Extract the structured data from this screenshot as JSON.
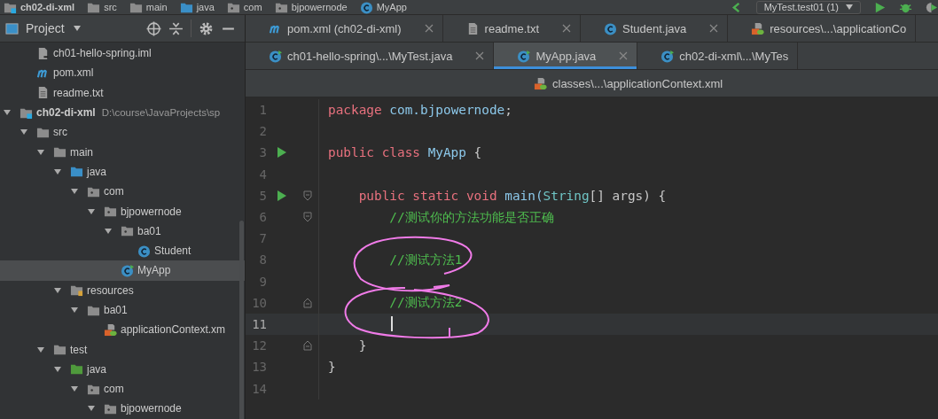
{
  "breadcrumbs": [
    {
      "label": "ch02-di-xml",
      "kind": "module"
    },
    {
      "label": "src",
      "kind": "folder"
    },
    {
      "label": "main",
      "kind": "folder"
    },
    {
      "label": "java",
      "kind": "source"
    },
    {
      "label": "com",
      "kind": "package"
    },
    {
      "label": "bjpowernode",
      "kind": "package"
    },
    {
      "label": "MyApp",
      "kind": "class"
    }
  ],
  "run_config": {
    "label": "MyTest.test01 (1)"
  },
  "project_panel": {
    "title": "Project"
  },
  "tree": {
    "scrolled_items": [
      {
        "label": "ch01-hello-spring.iml",
        "kind": "iml",
        "selected": false
      },
      {
        "label": "pom.xml",
        "kind": "maven",
        "selected": false
      },
      {
        "label": "readme.txt",
        "kind": "text",
        "selected": false
      }
    ],
    "items": [
      {
        "label": "ch02-di-xml",
        "hint": "D:\\course\\JavaProjects\\sp",
        "kind": "module",
        "selected": false,
        "expanded": true,
        "children": [
          {
            "label": "src",
            "kind": "folder",
            "selected": false,
            "expanded": true,
            "children": [
              {
                "label": "main",
                "kind": "folder",
                "selected": false,
                "expanded": true,
                "children": [
                  {
                    "label": "java",
                    "kind": "source",
                    "selected": false,
                    "expanded": true,
                    "children": [
                      {
                        "label": "com",
                        "kind": "package",
                        "selected": false,
                        "expanded": true,
                        "children": [
                          {
                            "label": "bjpowernode",
                            "kind": "package",
                            "selected": false,
                            "expanded": true,
                            "children": [
                              {
                                "label": "ba01",
                                "kind": "package",
                                "selected": false,
                                "expanded": true,
                                "children": [
                                  {
                                    "label": "Student",
                                    "kind": "class",
                                    "selected": false
                                  }
                                ]
                              },
                              {
                                "label": "MyApp",
                                "kind": "main",
                                "selected": true
                              }
                            ]
                          }
                        ]
                      }
                    ]
                  },
                  {
                    "label": "resources",
                    "kind": "resources",
                    "selected": false,
                    "expanded": true,
                    "children": [
                      {
                        "label": "ba01",
                        "kind": "folder",
                        "selected": false,
                        "expanded": true,
                        "children": [
                          {
                            "label": "applicationContext.xm",
                            "kind": "spring",
                            "selected": false
                          }
                        ]
                      }
                    ]
                  }
                ]
              },
              {
                "label": "test",
                "kind": "folder",
                "selected": false,
                "expanded": true,
                "children": [
                  {
                    "label": "java",
                    "kind": "test",
                    "selected": false,
                    "expanded": true,
                    "children": [
                      {
                        "label": "com",
                        "kind": "package",
                        "selected": false,
                        "expanded": true,
                        "children": [
                          {
                            "label": "bjpowernode",
                            "kind": "package",
                            "selected": false,
                            "expanded": true
                          }
                        ]
                      }
                    ]
                  }
                ]
              }
            ]
          }
        ]
      }
    ]
  },
  "tab_rows": [
    [
      {
        "label": "pom.xml (ch02-di-xml)",
        "kind": "maven",
        "selected": false
      },
      {
        "label": "readme.txt",
        "kind": "text",
        "selected": false
      },
      {
        "label": "Student.java",
        "kind": "class",
        "selected": false
      },
      {
        "label": "resources\\...\\applicationCo",
        "kind": "spring",
        "selected": false
      }
    ],
    [
      {
        "label": "ch01-hello-spring\\...\\MyTest.java",
        "kind": "main",
        "selected": false
      },
      {
        "label": "MyApp.java",
        "kind": "main",
        "selected": true
      },
      {
        "label": "ch02-di-xml\\...\\MyTes",
        "kind": "main",
        "selected": false
      }
    ],
    [
      {
        "label": "classes\\...\\applicationContext.xml",
        "kind": "spring",
        "selected": false
      }
    ]
  ],
  "editor": {
    "lines": [
      {
        "number": "1",
        "tokens": [
          {
            "text": "package",
            "kind": "keyword"
          },
          {
            "text": " com.bjpowernode",
            "kind": "name"
          },
          {
            "text": ";",
            "kind": "plain"
          }
        ]
      },
      {
        "number": "2"
      },
      {
        "number": "3",
        "run": true,
        "tokens": [
          {
            "text": "public class",
            "kind": "keyword"
          },
          {
            "text": " MyApp",
            "kind": "name"
          },
          {
            "text": " {",
            "kind": "plain"
          }
        ]
      },
      {
        "number": "4"
      },
      {
        "number": "5",
        "run": true,
        "fold_start": true,
        "tokens": [
          {
            "text": "    public static void",
            "kind": "keyword"
          },
          {
            "text": " main(",
            "kind": "name"
          },
          {
            "text": "String",
            "kind": "type"
          },
          {
            "text": "[] args) {",
            "kind": "plain"
          }
        ]
      },
      {
        "number": "6",
        "fold_start": true,
        "tokens": [
          {
            "text": "        //测试你的方法功能是否正确",
            "kind": "comment"
          }
        ]
      },
      {
        "number": "7"
      },
      {
        "number": "8",
        "tokens": [
          {
            "text": "        //测试方法1",
            "kind": "comment"
          }
        ]
      },
      {
        "number": "9"
      },
      {
        "number": "10",
        "fold_end": true,
        "tokens": [
          {
            "text": "        //测试方法2",
            "kind": "comment"
          }
        ]
      },
      {
        "number": "11",
        "current": true
      },
      {
        "number": "12",
        "fold_end": true,
        "tokens": [
          {
            "text": "    }",
            "kind": "plain"
          }
        ]
      },
      {
        "number": "13",
        "tokens": [
          {
            "text": "}",
            "kind": "plain"
          }
        ]
      },
      {
        "number": "14"
      }
    ]
  }
}
